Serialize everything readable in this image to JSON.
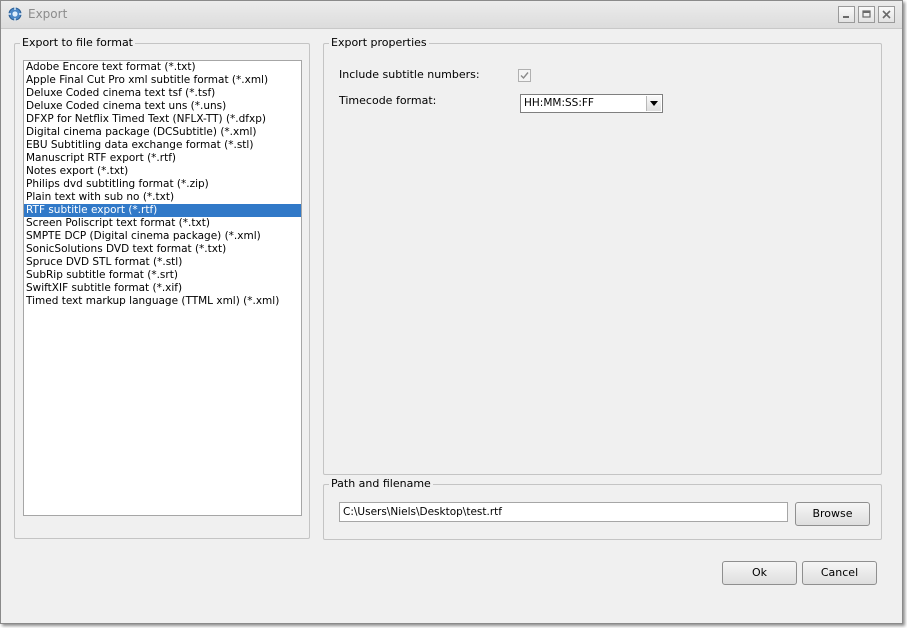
{
  "window": {
    "title": "Export"
  },
  "format_group": {
    "legend": "Export to file format",
    "selected_index": 11,
    "items": [
      "Adobe Encore text format (*.txt)",
      "Apple Final Cut Pro xml subtitle format (*.xml)",
      "Deluxe Coded cinema text tsf (*.tsf)",
      "Deluxe Coded cinema text uns (*.uns)",
      "DFXP for Netflix Timed Text (NFLX-TT) (*.dfxp)",
      "Digital cinema package (DCSubtitle) (*.xml)",
      "EBU Subtitling data exchange format (*.stl)",
      "Manuscript RTF export (*.rtf)",
      "Notes export (*.txt)",
      "Philips dvd subtitling format (*.zip)",
      "Plain text with sub no (*.txt)",
      "RTF subtitle export (*.rtf)",
      "Screen Poliscript text format (*.txt)",
      "SMPTE DCP (Digital cinema package) (*.xml)",
      "SonicSolutions DVD text format (*.txt)",
      "Spruce DVD STL format (*.stl)",
      "SubRip subtitle format (*.srt)",
      "SwiftXIF subtitle format (*.xif)",
      "Timed text markup language (TTML xml) (*.xml)"
    ]
  },
  "properties_group": {
    "legend": "Export properties",
    "include_numbers_label": "Include subtitle numbers:",
    "include_numbers_checked": true,
    "timecode_label": "Timecode format:",
    "timecode_value": "HH:MM:SS:FF"
  },
  "path_group": {
    "legend": "Path and filename",
    "path_value": "C:\\Users\\Niels\\Desktop\\test.rtf",
    "browse_label": "Browse"
  },
  "footer": {
    "ok_label": "Ok",
    "cancel_label": "Cancel"
  }
}
